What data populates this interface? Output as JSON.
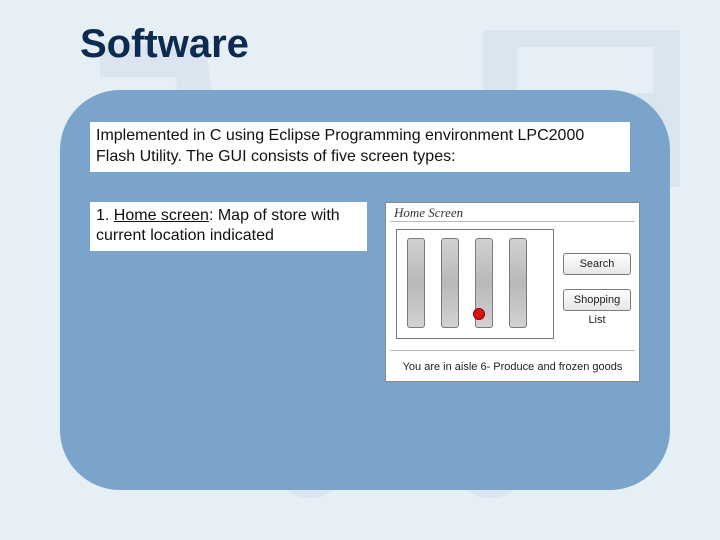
{
  "title": "Software",
  "intro": "Implemented in C using Eclipse  Programming environment LPC2000 Flash Utility. The GUI consists of five screen types:",
  "point_prefix": "1. ",
  "point_name": "Home screen",
  "point_rest": ": Map of store with current location indicated",
  "mock": {
    "header": "Home Screen",
    "search_label": "Search",
    "list_label": "Shopping List",
    "status": "You are in aisle 6- Produce and frozen goods"
  }
}
